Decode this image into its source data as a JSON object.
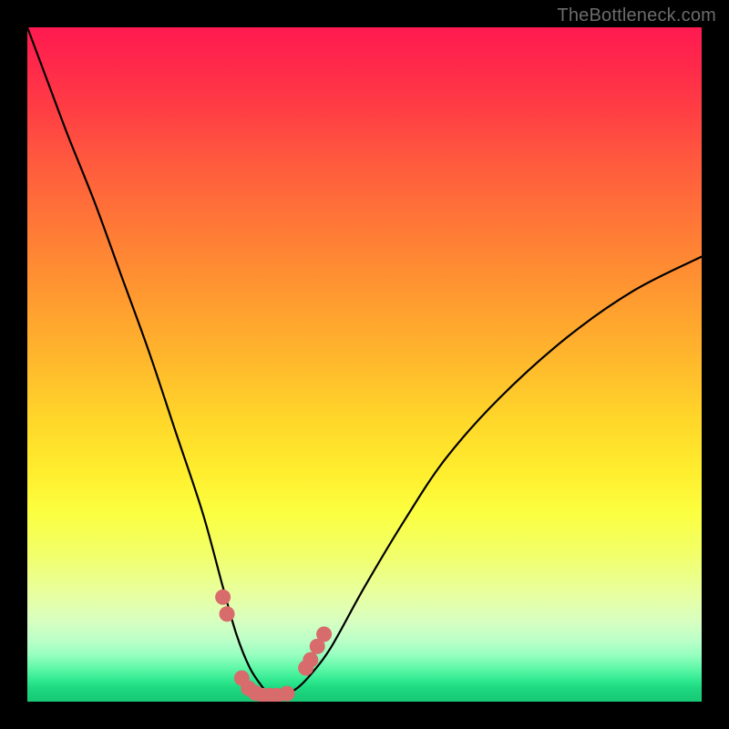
{
  "watermark": {
    "text": "TheBottleneck.com"
  },
  "chart_data": {
    "type": "line",
    "title": "",
    "xlabel": "",
    "ylabel": "",
    "xlim": [
      0,
      100
    ],
    "ylim": [
      0,
      100
    ],
    "series": [
      {
        "name": "bottleneck-curve",
        "x": [
          0,
          3,
          6,
          10,
          14,
          18,
          22,
          26,
          29,
          31,
          33,
          35,
          36,
          37,
          38,
          40,
          42,
          45,
          50,
          56,
          62,
          70,
          80,
          90,
          100
        ],
        "values": [
          100,
          92,
          84,
          74,
          63,
          52,
          40,
          28,
          17,
          10,
          5,
          2,
          1,
          1,
          1,
          2,
          4,
          8,
          17,
          27,
          36,
          45,
          54,
          61,
          66
        ]
      }
    ],
    "markers": {
      "name": "highlight-dots",
      "color": "#d86b6b",
      "x": [
        29.0,
        29.6,
        31.8,
        32.8,
        33.8,
        35.0,
        36.0,
        37.0,
        38.5,
        41.3,
        42.0,
        43.0,
        44.0
      ],
      "values": [
        15.5,
        13.0,
        3.5,
        2.0,
        1.3,
        0.9,
        0.9,
        0.9,
        1.2,
        5.0,
        6.2,
        8.2,
        10.0
      ]
    },
    "annotations": []
  }
}
